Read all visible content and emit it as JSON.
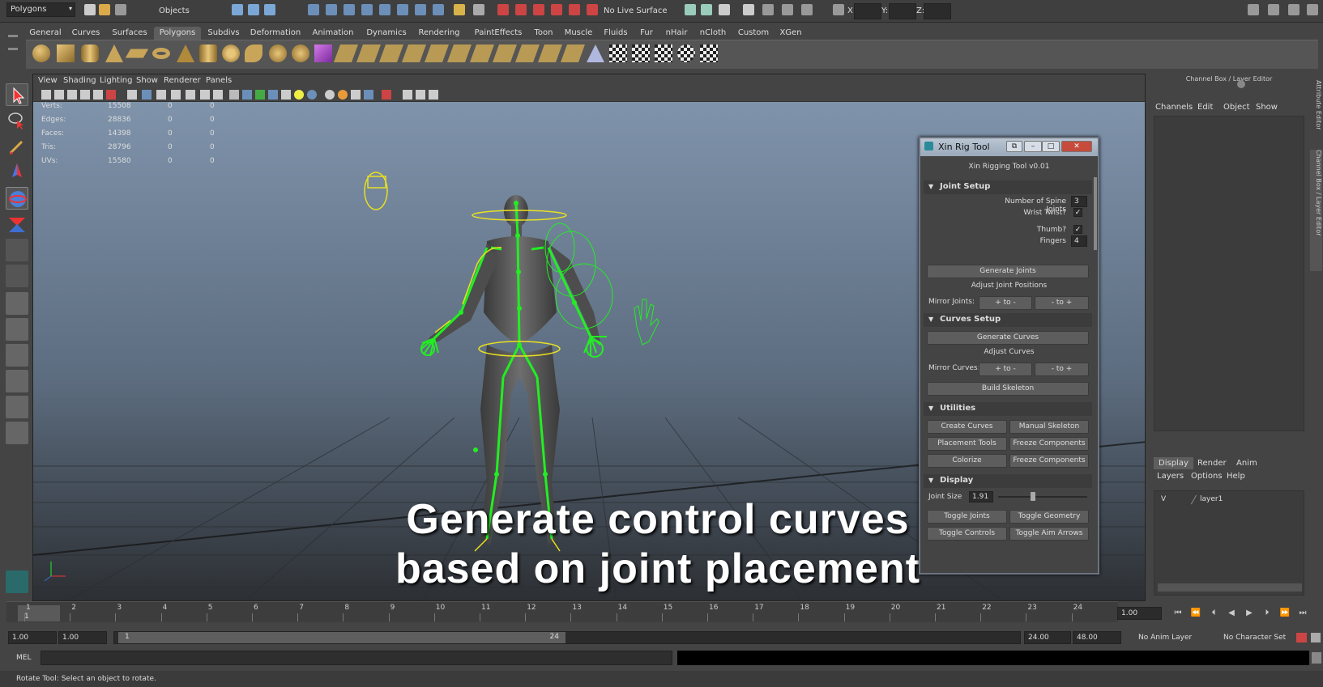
{
  "statusline": {
    "mode": "Polygons",
    "selection_mask": "Objects",
    "live_surface": "No Live Surface",
    "coord_x": "X:",
    "coord_y": "Y:",
    "coord_z": "Z:"
  },
  "shelf_tabs": [
    "General",
    "Curves",
    "Surfaces",
    "Polygons",
    "Subdivs",
    "Deformation",
    "Animation",
    "Dynamics",
    "Rendering",
    "PaintEffects",
    "Toon",
    "Muscle",
    "Fluids",
    "Fur",
    "nHair",
    "nCloth",
    "Custom",
    "XGen"
  ],
  "active_shelf_tab": "Polygons",
  "viewport": {
    "menu": [
      "View",
      "Shading",
      "Lighting",
      "Show",
      "Renderer",
      "Panels"
    ],
    "hud": [
      {
        "label": "Verts:",
        "v1": "15508",
        "v2": "0",
        "v3": "0"
      },
      {
        "label": "Edges:",
        "v1": "28836",
        "v2": "0",
        "v3": "0"
      },
      {
        "label": "Faces:",
        "v1": "14398",
        "v2": "0",
        "v3": "0"
      },
      {
        "label": "Tris:",
        "v1": "28796",
        "v2": "0",
        "v3": "0"
      },
      {
        "label": "UVs:",
        "v1": "15580",
        "v2": "0",
        "v3": "0"
      }
    ],
    "caption_line1": "Generate control curves",
    "caption_line2": "based on joint placement"
  },
  "rig_tool": {
    "title": "Xin Rig Tool",
    "subtitle": "Xin Rigging Tool v0.01",
    "joint_setup": {
      "heading": "Joint Setup",
      "spine_label": "Number of Spine Joints",
      "spine_value": "3",
      "wrist_label": "Wrist Twist?",
      "thumb_label": "Thumb?",
      "fingers_label": "Fingers",
      "fingers_value": "4",
      "generate_joints": "Generate Joints",
      "adjust_label": "Adjust Joint Positions",
      "mirror_label": "Mirror Joints:",
      "mirror_pos": "+ to -",
      "mirror_neg": "- to +"
    },
    "curves_setup": {
      "heading": "Curves Setup",
      "generate_curves": "Generate Curves",
      "adjust_label": "Adjust Curves",
      "mirror_label": "Mirror Curves:",
      "mirror_pos": "+ to -",
      "mirror_neg": "- to +",
      "build_skeleton": "Build Skeleton"
    },
    "utilities": {
      "heading": "Utilities",
      "create_curves": "Create Curves",
      "manual_skeleton": "Manual Skeleton",
      "placement_tools": "Placement Tools",
      "freeze_components_1": "Freeze Components",
      "colorize": "Colorize",
      "freeze_components_2": "Freeze Components"
    },
    "display": {
      "heading": "Display",
      "joint_size_label": "Joint Size",
      "joint_size_value": "1.91",
      "toggle_joints": "Toggle Joints",
      "toggle_geometry": "Toggle Geometry",
      "toggle_controls": "Toggle Controls",
      "toggle_aim_arrows": "Toggle Aim Arrows"
    }
  },
  "channel_box": {
    "title": "Channel Box / Layer Editor",
    "menu": [
      "Channels",
      "Edit",
      "Object",
      "Show"
    ],
    "tabs": [
      "Display",
      "Render",
      "Anim"
    ],
    "layer_menu": [
      "Layers",
      "Options",
      "Help"
    ],
    "layer_visible": "V",
    "layer_name": "layer1",
    "side_tabs": [
      "Attribute Editor",
      "Channel Box / Layer Editor"
    ]
  },
  "timeline": {
    "ticks": [
      "1",
      "2",
      "3",
      "4",
      "5",
      "6",
      "7",
      "8",
      "9",
      "10",
      "11",
      "12",
      "13",
      "14",
      "15",
      "16",
      "17",
      "18",
      "19",
      "20",
      "21",
      "22",
      "23",
      "24"
    ],
    "current_frame": "1",
    "current_time": "1.00"
  },
  "range": {
    "start": "1.00",
    "playback_start": "1.00",
    "handle_start": "1",
    "handle_end": "24",
    "playback_end": "24.00",
    "end": "48.00",
    "anim_layer": "No Anim Layer",
    "character_set": "No Character Set"
  },
  "cmdline": {
    "label": "MEL"
  },
  "helpline": {
    "text": "Rotate Tool: Select an object to rotate."
  },
  "colors": {
    "joint_green": "#22ee22",
    "curve_yellow": "#e8e020",
    "body": "#555555"
  }
}
